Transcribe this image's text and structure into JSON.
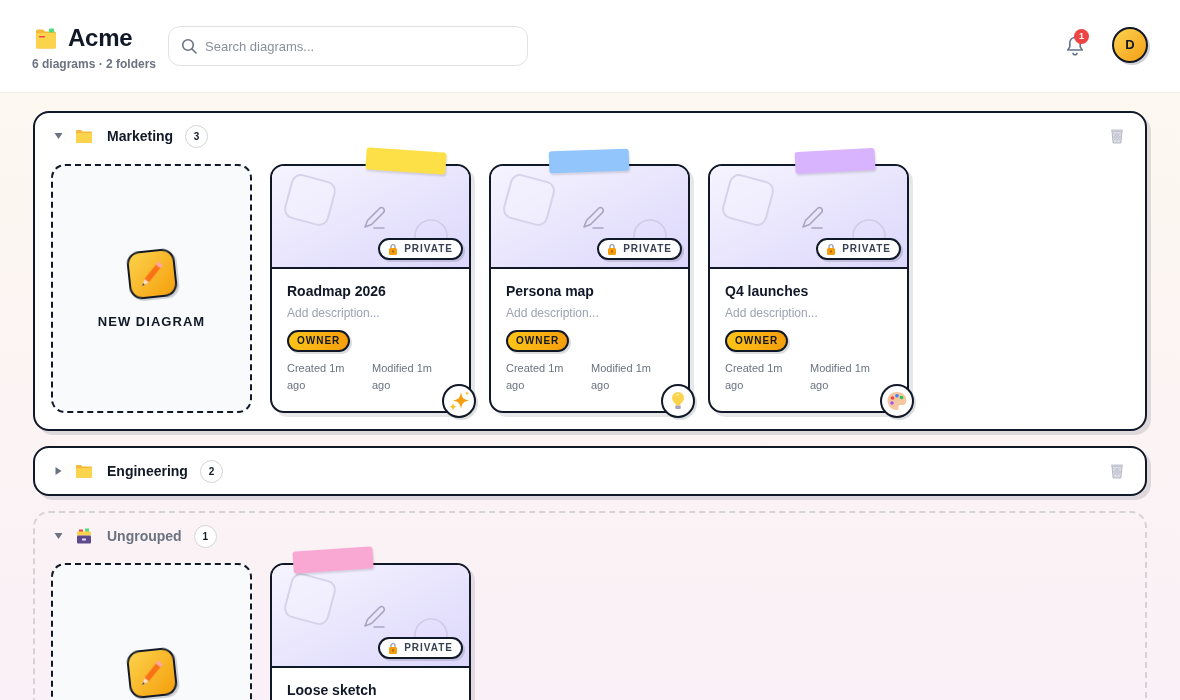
{
  "app": {
    "name": "Acme",
    "summary": "6 diagrams · 2 folders"
  },
  "search": {
    "placeholder": "Search diagrams..."
  },
  "notifications": {
    "count": "1"
  },
  "user": {
    "initial": "D"
  },
  "folders": [
    {
      "kind": "folder",
      "name": "Marketing",
      "count": "3",
      "expanded": true,
      "new_card_label": "NEW DIAGRAM",
      "diagrams": [
        {
          "title": "Roadmap 2026",
          "description": {
            "placeholder": "Add description..."
          },
          "visibility": "PRIVATE",
          "role": "OWNER",
          "created": "Created 1m ago",
          "modified": "Modified 1m ago",
          "color": "#fde047",
          "kind": "sparkles"
        },
        {
          "title": "Persona map",
          "description": {
            "placeholder": "Add description..."
          },
          "visibility": "PRIVATE",
          "role": "OWNER",
          "created": "Created 1m ago",
          "modified": "Modified 1m ago",
          "color": "#93c5fd",
          "kind": "bulb"
        },
        {
          "title": "Q4 launches",
          "description": {
            "placeholder": "Add description..."
          },
          "visibility": "PRIVATE",
          "role": "OWNER",
          "created": "Created 1m ago",
          "modified": "Modified 1m ago",
          "color": "#d8b4fe",
          "kind": "palette"
        }
      ]
    },
    {
      "kind": "folder",
      "name": "Engineering",
      "count": "2",
      "expanded": false
    },
    {
      "kind": "ungrouped",
      "name": "Ungrouped",
      "count": "1",
      "expanded": true,
      "diagrams": [
        {
          "title": "Loose sketch",
          "visibility": "PRIVATE",
          "color": "#f9a8d4"
        }
      ]
    }
  ]
}
